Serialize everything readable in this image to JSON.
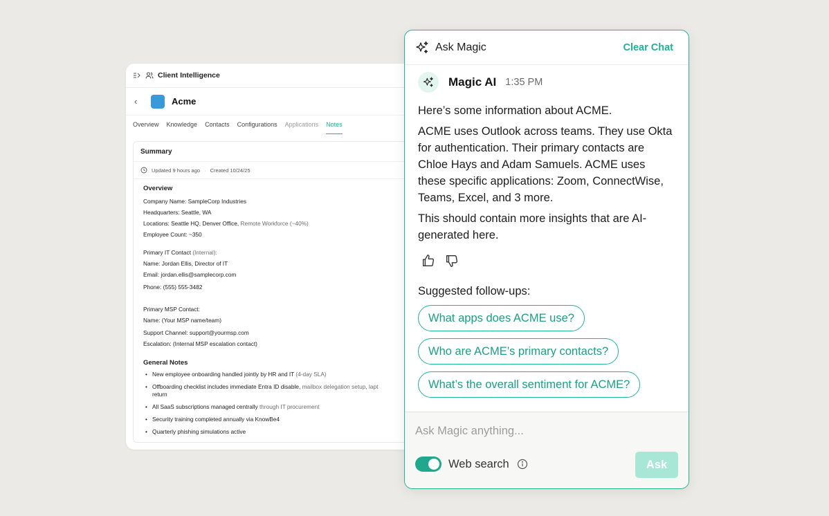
{
  "colors": {
    "accent": "#20b196",
    "accent_light": "#a8e6d6",
    "background": "#ebeae6",
    "company_logo": "#3a9ad9"
  },
  "client": {
    "top_title": "Client Intelligence",
    "icons": [
      "sidebar-toggle-icon",
      "users-icon",
      "back-chevron-icon",
      "clock-icon"
    ],
    "company_name": "Acme",
    "tabs": [
      "Overview",
      "Knowledge",
      "Contacts",
      "Configurations",
      "Applications",
      "Notes"
    ],
    "active_tab": "Notes",
    "summary": {
      "title": "Summary",
      "updated": "Updated 9 hours ago",
      "created": "Created 10/24/25",
      "overview_heading": "Overview",
      "company_name_key": "Company Name:",
      "company_name_val": "SampleCorp Industries",
      "hq_key": "Headquarters:",
      "hq_val": "Seattle, WA",
      "locations_key": "Locations:",
      "locations_val": "Seattle HQ, Denver Office,",
      "locations_extra": "Remote Workforce (~40%)",
      "employee_key": "Employee Count:",
      "employee_val": "~350",
      "primary_it_key": "Primary IT Contact",
      "primary_it_extra": "(Internal):",
      "it_name": "Name: Jordan Ellis, Director of IT",
      "it_email": "Email: jordan.ellis@samplecorp.com",
      "it_phone": "Phone: (555) 555-3482",
      "msp_heading": "Primary MSP Contact:",
      "msp_name": "Name: (Your MSP name/team)",
      "msp_support": "Support Channel: support@yourmsp.com",
      "msp_escalation": "Escalation: (Internal MSP escalation contact)",
      "notes_heading": "General Notes",
      "notes": [
        {
          "main": "New employee onboarding handled jointly by HR and IT",
          "extra": " (4-day SLA)"
        },
        {
          "main": "Offboarding checklist includes immediate Entra ID disable,",
          "extra": " mailbox delegation setup, lapt",
          "line2": "return"
        },
        {
          "main": "All SaaS subscriptions managed centrally",
          "extra": " through IT procurement"
        },
        {
          "main": "Security training completed annually via KnowBe4",
          "extra": ""
        },
        {
          "main": "Quarterly phishing simulations active",
          "extra": ""
        }
      ]
    }
  },
  "magic": {
    "title": "Ask Magic",
    "clear_label": "Clear Chat",
    "author": "Magic AI",
    "time": "1:35 PM",
    "paragraphs": [
      "Here’s some information about ACME.",
      "ACME uses Outlook across teams. They use Okta for authentication. Their primary contacts are Chloe Hays and Adam Samuels. ACME uses these specific applications: Zoom, ConnectWise, Teams, Excel, and 3 more.",
      "This should contain more insights that are AI-generated here."
    ],
    "followups_title": "Suggested follow-ups:",
    "followups": [
      "What apps does ACME use?",
      "Who are ACME’s primary contacts?",
      "What’s the overall sentiment for ACME?"
    ],
    "input_placeholder": "Ask Magic anything...",
    "web_search_label": "Web search",
    "web_search_on": true,
    "ask_label": "Ask",
    "icons": [
      "sparkle-icon",
      "thumbs-up-icon",
      "thumbs-down-icon",
      "info-icon"
    ]
  }
}
